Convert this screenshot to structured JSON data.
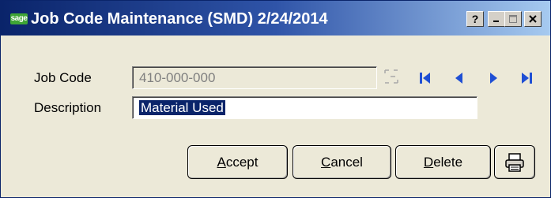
{
  "window": {
    "app_icon_text": "sage",
    "title": "Job Code  Maintenance (SMD) 2/24/2014",
    "caption_buttons": {
      "help": "?",
      "minimize": "_",
      "maximize": "□",
      "close": "X"
    }
  },
  "form": {
    "job_code_label": "Job Code",
    "job_code_value": "410-000-000",
    "description_label": "Description",
    "description_value": "Material Used"
  },
  "navigation": {
    "lookup_icon": "lookup-icon",
    "first_icon": "first-record-icon",
    "prev_icon": "previous-record-icon",
    "next_icon": "next-record-icon",
    "last_icon": "last-record-icon"
  },
  "buttons": {
    "accept": {
      "accel": "A",
      "rest": "ccept"
    },
    "cancel": {
      "accel": "C",
      "rest": "ancel"
    },
    "delete": {
      "accel": "D",
      "rest": "elete"
    },
    "print_icon": "printer-icon"
  },
  "colors": {
    "title_bar_start": "#0a246a",
    "title_bar_end": "#a6caf0",
    "window_background": "#ece9d8",
    "selection": "#0a246a",
    "nav_arrow": "#1f4fd4",
    "sage_green": "#3fa535"
  }
}
